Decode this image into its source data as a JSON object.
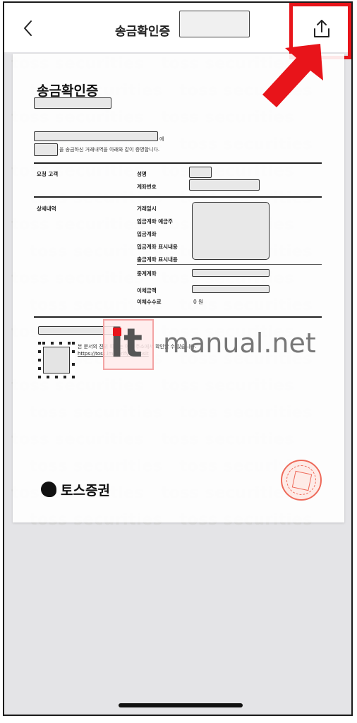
{
  "nav": {
    "title": "송금확인증"
  },
  "watermark": {
    "text": "toss securities"
  },
  "document": {
    "title": "송금확인증",
    "intro_suffix": "에",
    "intro_line": "을 송금하신 거래내역을 아래와 같이 증명합니다.",
    "sections": {
      "requester": "요청 고객",
      "details": "상세내역"
    },
    "fields": {
      "name": "성명",
      "account_number": "계좌번호",
      "transaction_datetime": "거래일시",
      "deposit_account_holder": "입금계좌 예금주",
      "deposit_account": "입금계좌",
      "deposit_display": "입금계좌 표시내용",
      "withdrawal_display": "출금계좌 표시내용",
      "intermediary_account": "중계계좌",
      "transfer_amount": "이체금액",
      "transfer_fee": "이체수수료",
      "transfer_fee_value": "0 원"
    },
    "verify_note": "본 문서의 진위 여부는 아래 주소에서 확인할 수 있습니다.",
    "verify_url": "https://toss.im/verify-deposit",
    "brand": "토스증권"
  },
  "overlay": {
    "site_it": "it",
    "site_name": "manual.net"
  },
  "colors": {
    "highlight": "#e8141a",
    "background": "#e4e4e7",
    "seal": "#ee6a5a"
  }
}
